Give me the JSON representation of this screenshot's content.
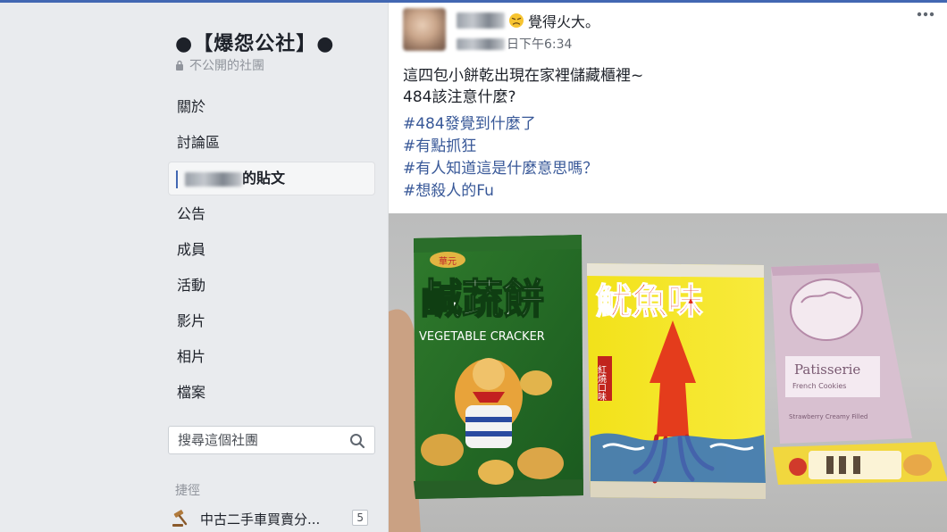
{
  "sidebar": {
    "group_title": "●【爆怨公社】●",
    "privacy": "不公開的社團",
    "nav": [
      {
        "label": "關於"
      },
      {
        "label": "討論區"
      },
      {
        "label": "的貼文",
        "active": true
      },
      {
        "label": "公告"
      },
      {
        "label": "成員"
      },
      {
        "label": "活動"
      },
      {
        "label": "影片"
      },
      {
        "label": "相片"
      },
      {
        "label": "檔案"
      }
    ],
    "search_placeholder": "搜尋這個社團",
    "shortcuts_title": "捷徑",
    "shortcut": {
      "label": "中古二手車買賣分...",
      "count": "5"
    }
  },
  "post": {
    "author_status": "覺得火大。",
    "timestamp": "日下午6:34",
    "text_lines": [
      "這四包小餅乾出現在家裡儲藏櫃裡~",
      "484該注意什麼?"
    ],
    "hashtags": [
      "#484發覺到什麼了",
      "#有點抓狂",
      "#有人知道這是什麼意思嗎？",
      "#想殺人的Fu"
    ],
    "photo": {
      "pack1": {
        "brand": "華元",
        "title": "鹹蔬餅",
        "subtitle": "VEGETABLE CRACKER"
      },
      "pack2": {
        "title": "魷魚味",
        "side": "紅燒口味"
      },
      "pack3": {
        "title": "Patisserie",
        "subtitle": "French Cookies",
        "flavor": "Strawberry Creamy Filled"
      }
    }
  },
  "colors": {
    "accent": "#4267b2",
    "link": "#385898",
    "bg": "#e9ebee"
  }
}
